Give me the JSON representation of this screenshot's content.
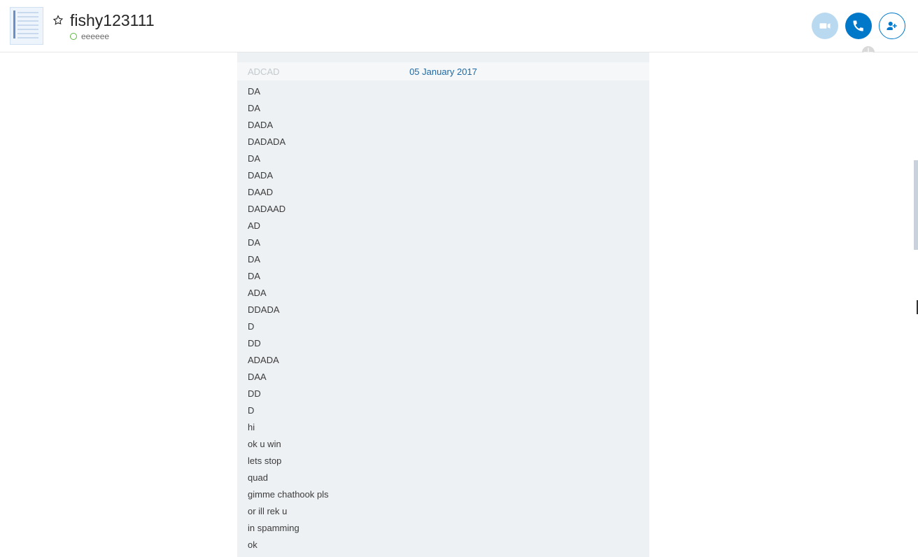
{
  "header": {
    "contact_name": "fishy123111",
    "status_text": "eeeeee"
  },
  "date_separator": "05 January 2017",
  "faint_text": "ADCAD",
  "messages": [
    "DA",
    "DA",
    "DADA",
    "DADADA",
    "DA",
    "DADA",
    "DAAD",
    "DADAAD",
    "AD",
    "DA",
    "DA",
    "DA",
    "ADA",
    "DDADA",
    "D",
    "DD",
    "ADADA",
    "DAA",
    "DD",
    "D",
    "hi",
    "ok u win",
    "lets stop",
    "quad",
    "gimme chathook pls",
    "or ill rek u",
    "in spamming",
    "ok"
  ]
}
